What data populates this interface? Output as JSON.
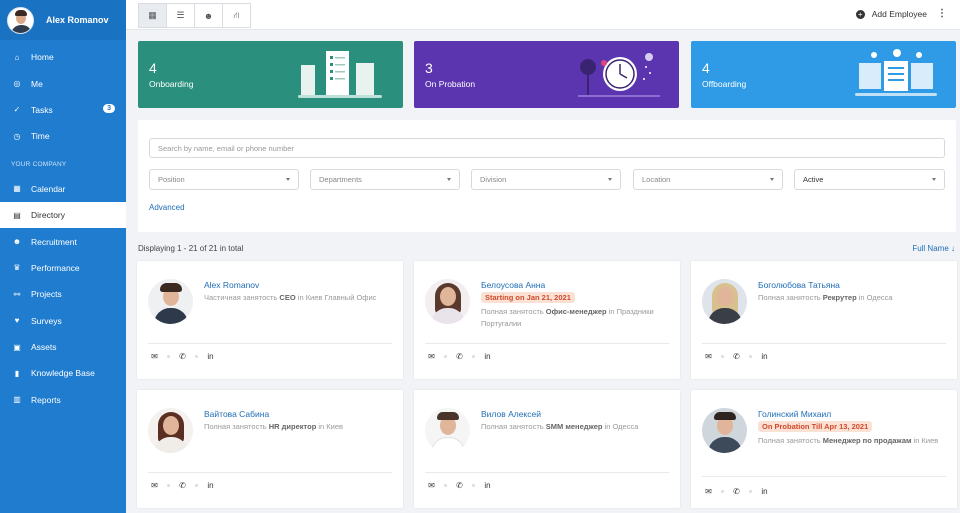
{
  "user": {
    "name": "Alex Romanov"
  },
  "sidebar": {
    "items": [
      {
        "label": "Home",
        "icon": "home-icon",
        "glyph": "⌂"
      },
      {
        "label": "Me",
        "icon": "user-circle-icon",
        "glyph": "◎"
      },
      {
        "label": "Tasks",
        "icon": "check-circle-icon",
        "glyph": "✓",
        "badge": "3"
      },
      {
        "label": "Time",
        "icon": "clock-icon",
        "glyph": "◷"
      }
    ],
    "section_label": "YOUR COMPANY",
    "company_items": [
      {
        "label": "Calendar",
        "icon": "calendar-icon",
        "glyph": "▦"
      },
      {
        "label": "Directory",
        "icon": "address-book-icon",
        "glyph": "▤",
        "active": true
      },
      {
        "label": "Recruitment",
        "icon": "users-icon",
        "glyph": "☻"
      },
      {
        "label": "Performance",
        "icon": "trophy-icon",
        "glyph": "♛"
      },
      {
        "label": "Projects",
        "icon": "project-diagram-icon",
        "glyph": "⚯"
      },
      {
        "label": "Surveys",
        "icon": "heart-icon",
        "glyph": "♥"
      },
      {
        "label": "Assets",
        "icon": "cubes-icon",
        "glyph": "▣"
      },
      {
        "label": "Knowledge Base",
        "icon": "book-icon",
        "glyph": "▮"
      },
      {
        "label": "Reports",
        "icon": "chart-bar-icon",
        "glyph": "▥"
      }
    ]
  },
  "topbar": {
    "views": [
      {
        "icon": "grid-view-icon",
        "glyph": "▦"
      },
      {
        "icon": "list-view-icon",
        "glyph": "☰"
      },
      {
        "icon": "team-view-icon",
        "glyph": "☻"
      },
      {
        "icon": "org-chart-icon",
        "glyph": "⛙"
      }
    ],
    "add_employee": "Add Employee",
    "more_glyph": "⋮"
  },
  "stats": [
    {
      "count": "4",
      "label": "Onboarding",
      "color": "#2b8f7d"
    },
    {
      "count": "3",
      "label": "On Probation",
      "color": "#5b34b0"
    },
    {
      "count": "4",
      "label": "Offboarding",
      "color": "#2f9ae6"
    }
  ],
  "filters": {
    "search_placeholder": "Search by name, email or phone number",
    "selects": [
      "Position",
      "Departments",
      "Division",
      "Location",
      "Active"
    ],
    "advanced": "Advanced"
  },
  "list": {
    "count_text": "Displaying 1 - 21 of 21 in total",
    "sort_label": "Full Name ↓"
  },
  "employees": [
    {
      "name": "Alex Romanov",
      "desc_pre": "Частичная занятость ",
      "role": "CEO",
      "desc_post": " in Киев Главный Офис",
      "badge": ""
    },
    {
      "name": "Белоусова Анна",
      "desc_pre": "Полная занятость ",
      "role": "Офис-менеджер",
      "desc_post": " in Праздники Португалии",
      "badge": "Starting on Jan 21, 2021"
    },
    {
      "name": "Боголюбова Татьяна",
      "desc_pre": "Полная занятость ",
      "role": "Рекрутер",
      "desc_post": " in Одесса",
      "badge": ""
    },
    {
      "name": "Вайтова Сабина",
      "desc_pre": "Полная занятость ",
      "role": "HR директор",
      "desc_post": " in Киев",
      "badge": ""
    },
    {
      "name": "Вилов Алексей",
      "desc_pre": "Полная занятость ",
      "role": "SMM менеджер",
      "desc_post": " in Одесса",
      "badge": ""
    },
    {
      "name": "Голинский Михаил",
      "desc_pre": "Полная занятость ",
      "role": "Менеджер по продажам",
      "desc_post": " in Киев",
      "badge": "On Probation Till Apr 13, 2021"
    }
  ],
  "card_actions": [
    {
      "icon": "envelope-icon",
      "glyph": "✉"
    },
    {
      "icon": "phone-icon",
      "glyph": "✆"
    },
    {
      "icon": "linkedin-icon",
      "glyph": "in"
    }
  ]
}
